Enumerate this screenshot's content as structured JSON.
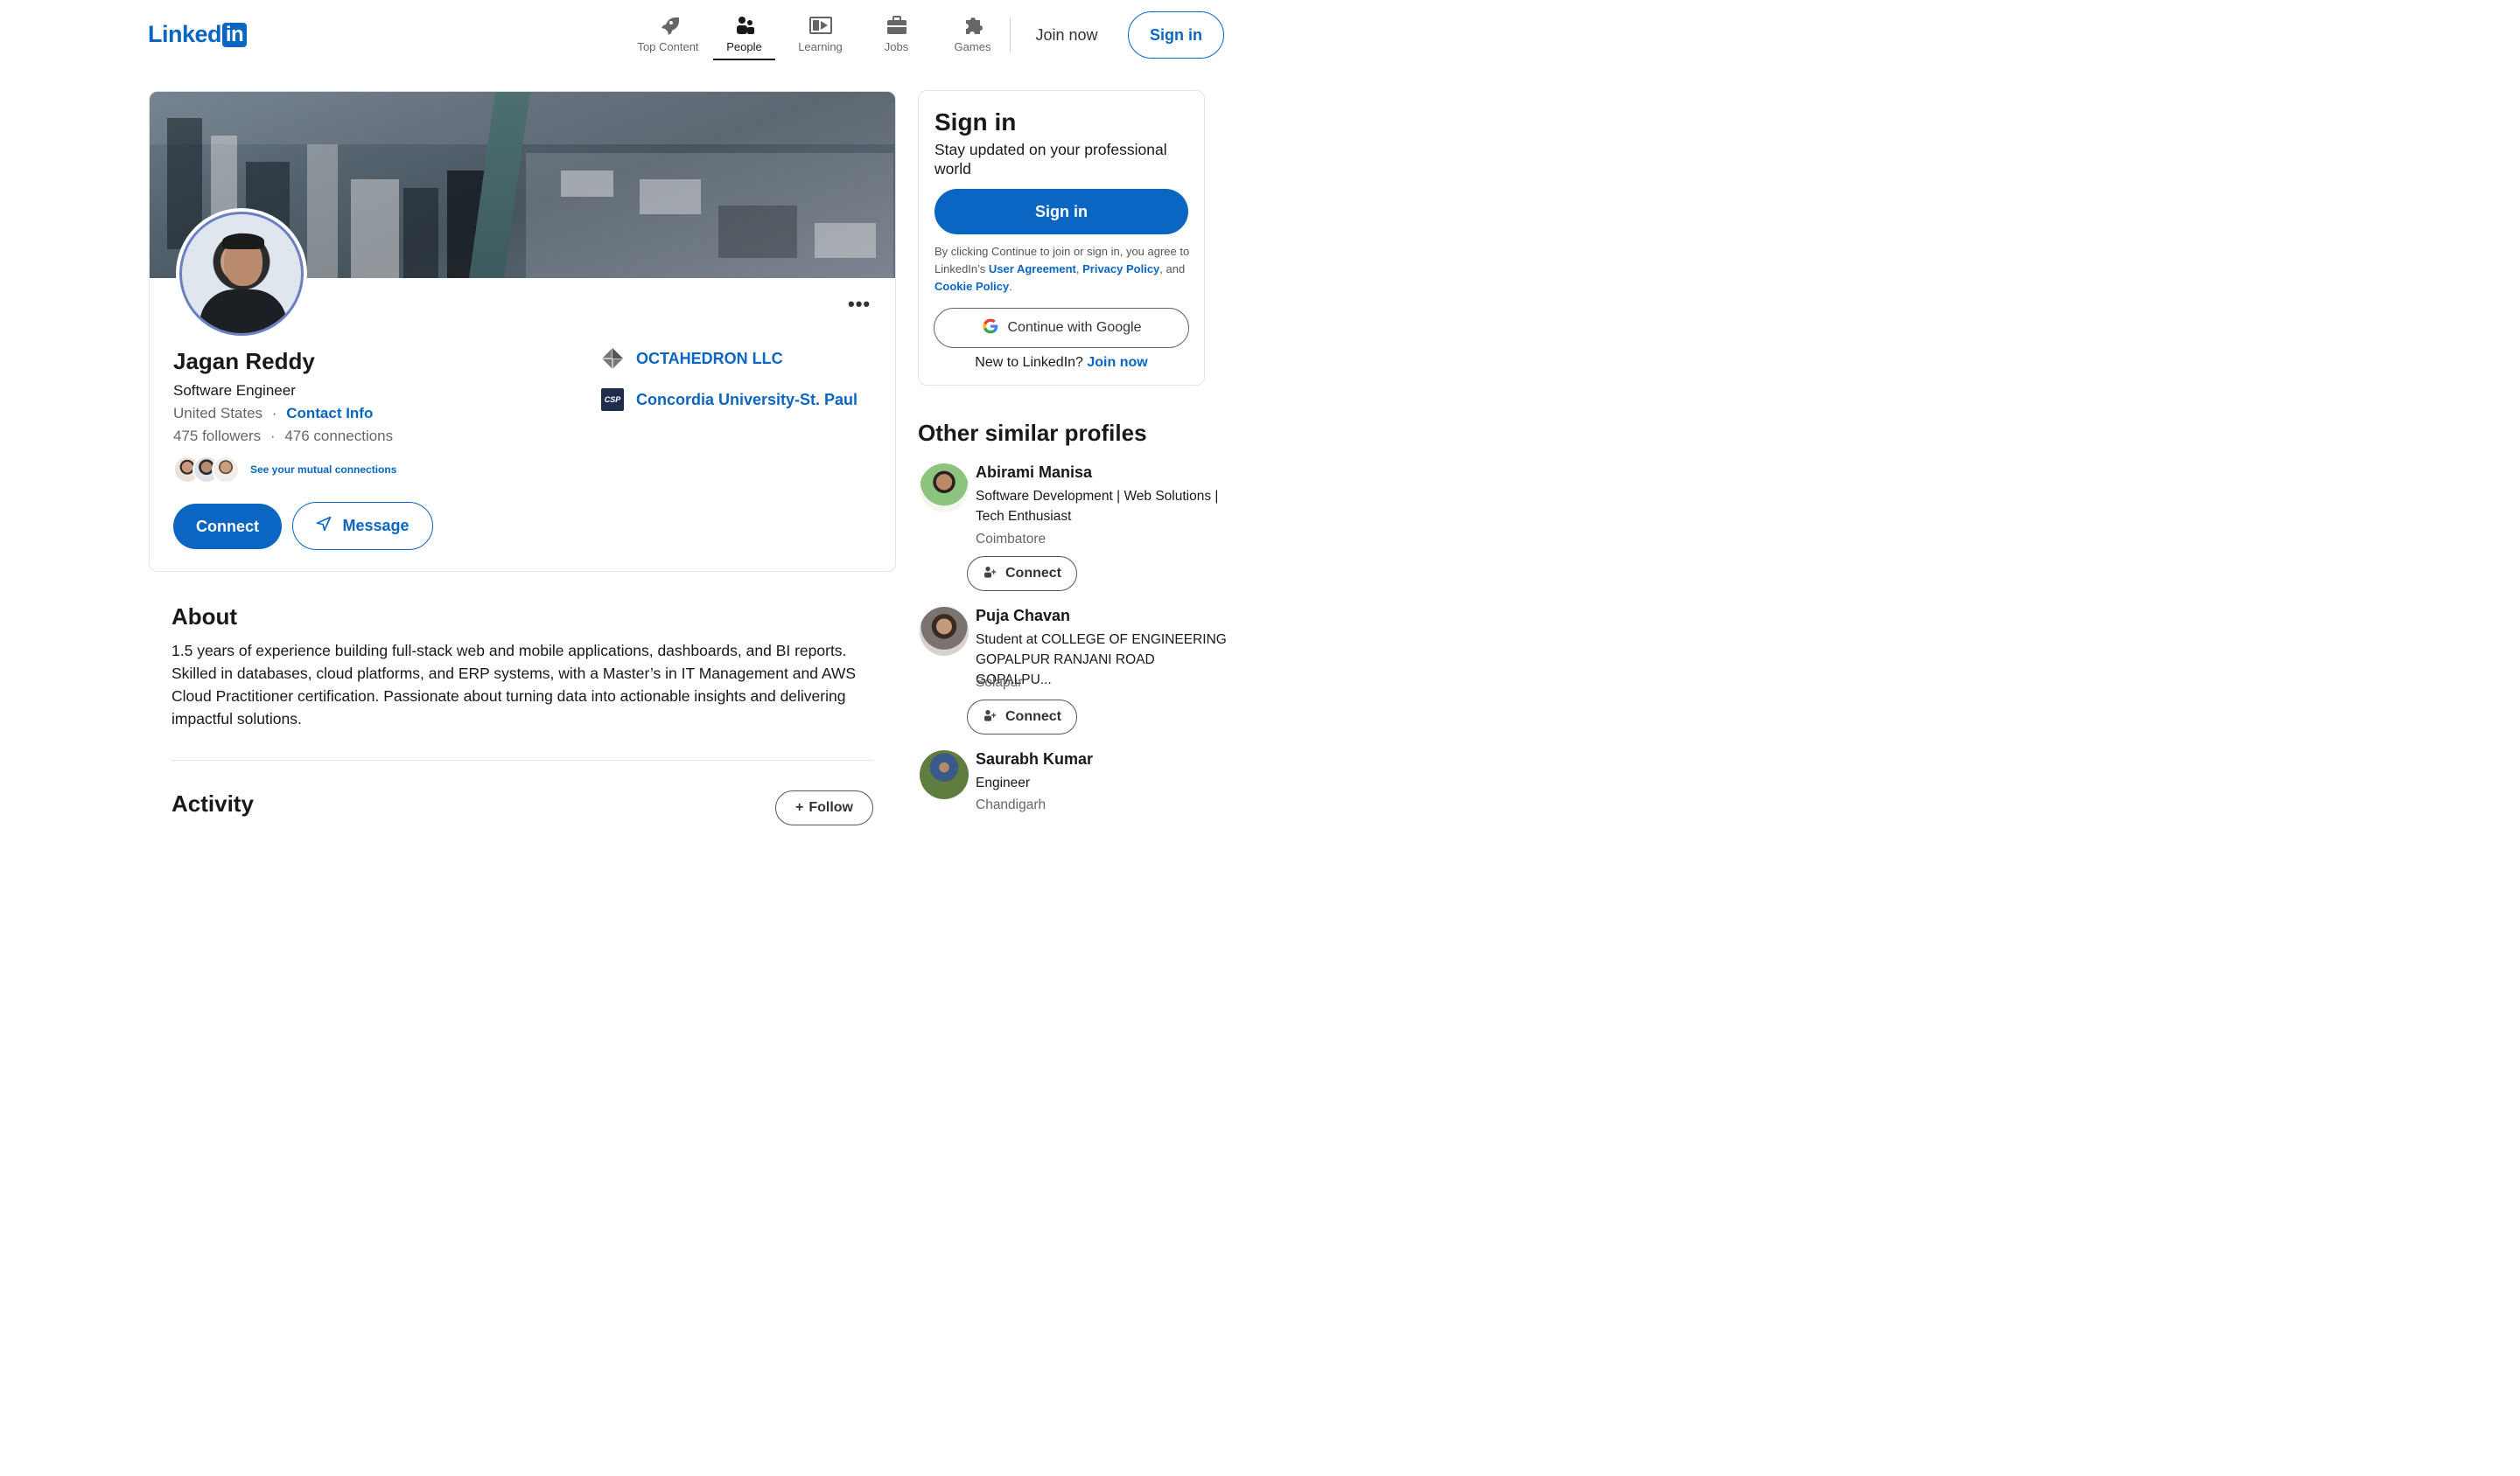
{
  "nav": {
    "logo_text": "Linked",
    "logo_box": "in",
    "items": [
      {
        "label": "Top Content",
        "icon": "rocket-icon"
      },
      {
        "label": "People",
        "icon": "people-icon",
        "active": true
      },
      {
        "label": "Learning",
        "icon": "learning-icon"
      },
      {
        "label": "Jobs",
        "icon": "briefcase-icon"
      },
      {
        "label": "Games",
        "icon": "puzzle-icon"
      }
    ],
    "join_now": "Join now",
    "sign_in": "Sign in"
  },
  "profile": {
    "name": "Jagan Reddy",
    "headline": "Software Engineer",
    "location": "United States",
    "separator": "·",
    "contact_info": "Contact Info",
    "followers": "475 followers",
    "connections": "476 connections",
    "mutual_link": "See your mutual connections",
    "connect": "Connect",
    "message": "Message",
    "more": "•••",
    "experience": [
      {
        "name": "OCTAHEDRON LLC",
        "logo": "octahedron-logo"
      },
      {
        "name": "Concordia University-St. Paul",
        "logo": "csp-logo",
        "logo_text": "CSP"
      }
    ]
  },
  "about": {
    "title": "About",
    "text": "1.5 years of experience building full-stack web and mobile applications, dashboards, and BI reports. Skilled in databases, cloud platforms, and ERP systems, with a Master’s in IT Management and AWS Cloud Practitioner certification. Passionate about turning data into actionable insights and delivering impactful solutions."
  },
  "activity": {
    "title": "Activity",
    "follow": "Follow"
  },
  "signin_card": {
    "title": "Sign in",
    "subtitle": "Stay updated on your professional world",
    "button": "Sign in",
    "legal_prefix": "By clicking Continue to join or sign in, you agree to LinkedIn’s ",
    "user_agreement": "User Agreement",
    "comma": ", ",
    "privacy_policy": "Privacy Policy",
    "and": ", and ",
    "cookie_policy": "Cookie Policy",
    "period": ".",
    "google": "Continue with Google",
    "new_prefix": "New to LinkedIn? ",
    "join_now": "Join now"
  },
  "similar": {
    "title": "Other similar profiles",
    "connect_label": "Connect",
    "profiles": [
      {
        "name": "Abirami Manisa",
        "headline": "Software Development | Web Solutions | Tech Enthusiast",
        "location": "Coimbatore"
      },
      {
        "name": "Puja Chavan",
        "headline": "Student at COLLEGE OF ENGINEERING GOPALPUR RANJANI ROAD GOPALPU...",
        "location": "Solapur"
      },
      {
        "name": "Saurabh Kumar",
        "headline": "Engineer",
        "location": "Chandigarh"
      }
    ]
  }
}
